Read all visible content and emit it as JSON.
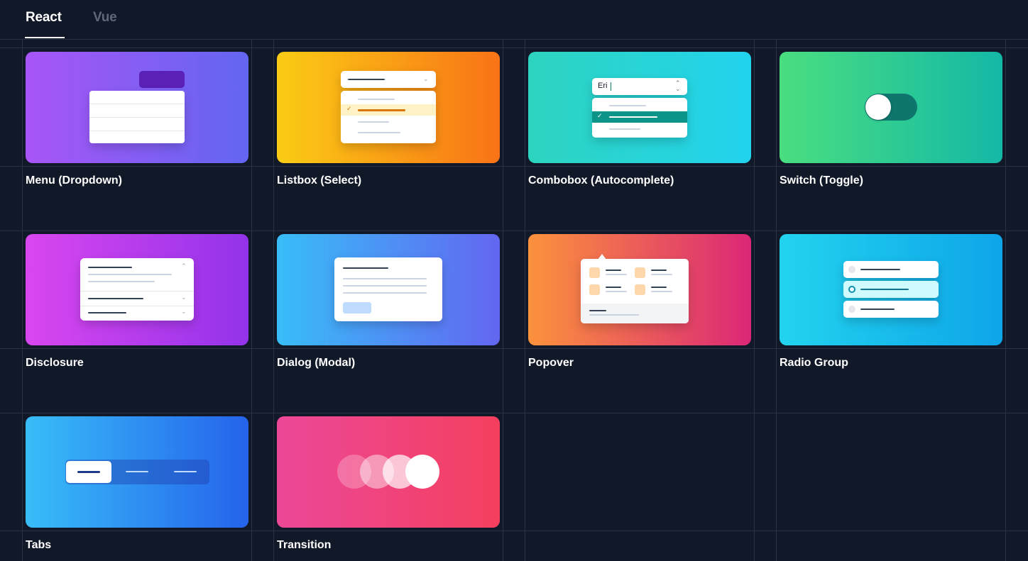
{
  "tabs": [
    {
      "label": "React",
      "active": true
    },
    {
      "label": "Vue",
      "active": false
    }
  ],
  "components": [
    {
      "label": "Menu (Dropdown)",
      "gradient": [
        "#a855f7",
        "#6366f1"
      ]
    },
    {
      "label": "Listbox (Select)",
      "gradient": [
        "#facc15",
        "#f97316"
      ]
    },
    {
      "label": "Combobox (Autocomplete)",
      "gradient": [
        "#2dd4bf",
        "#22d3ee"
      ]
    },
    {
      "label": "Switch (Toggle)",
      "gradient": [
        "#4ade80",
        "#14b8a6"
      ]
    },
    {
      "label": "Disclosure",
      "gradient": [
        "#d946ef",
        "#9333ea"
      ]
    },
    {
      "label": "Dialog (Modal)",
      "gradient": [
        "#38bdf8",
        "#6366f1"
      ]
    },
    {
      "label": "Popover",
      "gradient": [
        "#fb923c",
        "#db2777"
      ]
    },
    {
      "label": "Radio Group",
      "gradient": [
        "#22d3ee",
        "#0ea5e9"
      ]
    },
    {
      "label": "Tabs",
      "gradient": [
        "#38bdf8",
        "#2563eb"
      ]
    },
    {
      "label": "Transition",
      "gradient": [
        "#ec4899",
        "#f43f5e"
      ]
    }
  ],
  "combobox_preview": {
    "input_value": "Eri"
  },
  "colors": {
    "background": "#111827",
    "grid_line": "#2a3142",
    "inactive_tab": "#5f6878"
  }
}
